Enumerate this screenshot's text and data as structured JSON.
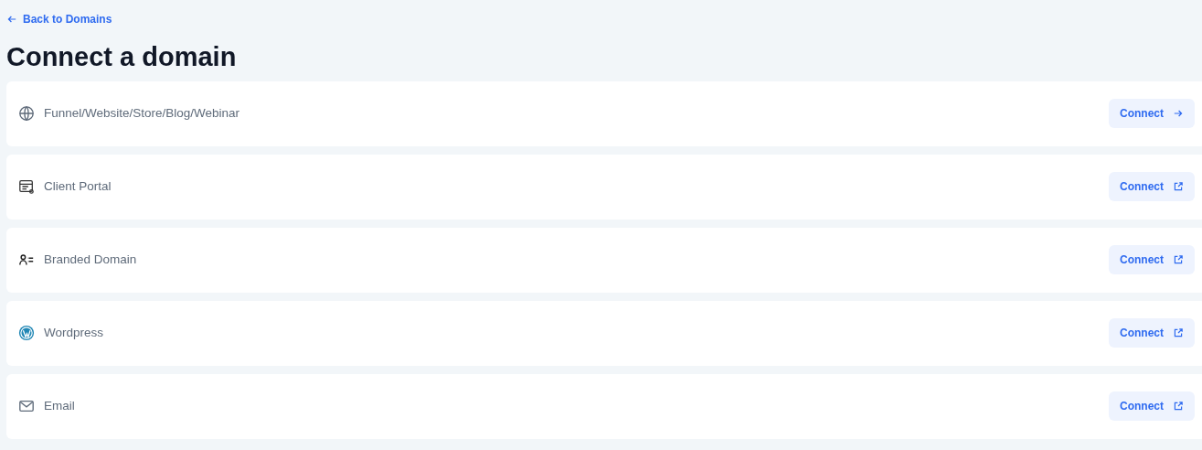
{
  "back_link": "Back to Domains",
  "title": "Connect a domain",
  "domains": [
    {
      "label": "Funnel/Website/Store/Blog/Webinar",
      "kind": "website",
      "button": {
        "label": "Connect",
        "kind": "internal"
      }
    },
    {
      "label": "Client Portal",
      "kind": "portal",
      "button": {
        "label": "Connect",
        "kind": "external"
      }
    },
    {
      "label": "Branded Domain",
      "kind": "branded",
      "button": {
        "label": "Connect",
        "kind": "external"
      }
    },
    {
      "label": "Wordpress",
      "kind": "wordpress",
      "button": {
        "label": "Connect",
        "kind": "external"
      }
    },
    {
      "label": "Email",
      "kind": "email",
      "button": {
        "label": "Connect",
        "kind": "external"
      }
    }
  ]
}
